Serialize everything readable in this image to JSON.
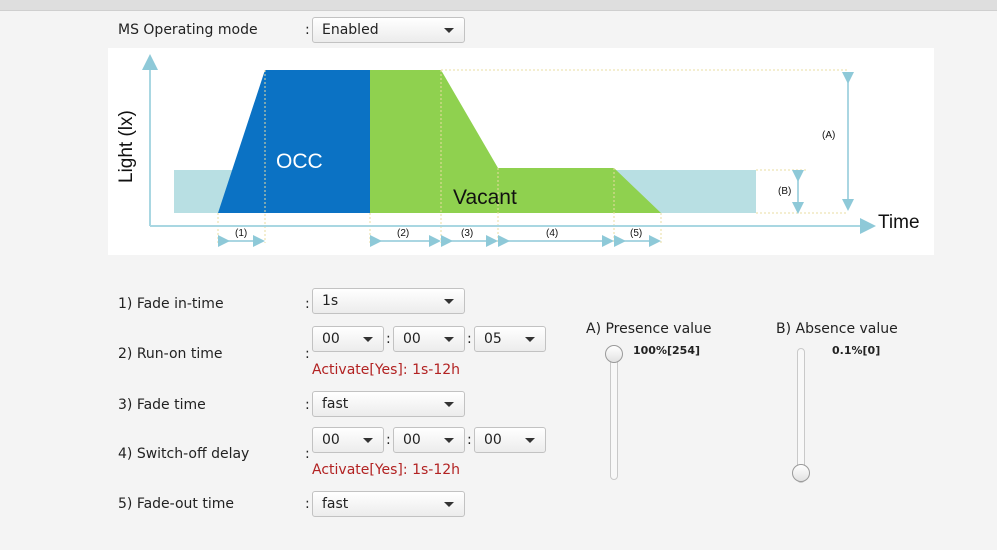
{
  "mode": {
    "label": "MS Operating mode",
    "colon": ":",
    "value": "Enabled"
  },
  "diagram": {
    "y_axis_label": "Light (lx)",
    "x_axis_label": "Time",
    "occ_label": "OCC",
    "vacant_label": "Vacant",
    "level_a_label": "(A)",
    "level_b_label": "(B)",
    "segments": [
      "(1)",
      "(2)",
      "(3)",
      "(4)",
      "(5)"
    ],
    "colors": {
      "occ": "#0b72c4",
      "vacant": "#8fd14f",
      "base": "#b8dfe3",
      "arrow": "#8ec9d8"
    }
  },
  "settings": {
    "fade_in": {
      "label": "1) Fade in-time",
      "colon": ":",
      "value": "1s"
    },
    "run_on": {
      "label": "2) Run-on time",
      "colon": ":",
      "hh": "00",
      "mm": "00",
      "ss": "05",
      "sep": ":",
      "hint": "Activate[Yes]: 1s-12h"
    },
    "fade_time": {
      "label": "3) Fade time",
      "colon": ":",
      "value": "fast"
    },
    "switch_off": {
      "label": "4) Switch-off delay",
      "colon": ":",
      "hh": "00",
      "mm": "00",
      "ss": "00",
      "sep": ":",
      "hint": "Activate[Yes]: 1s-12h"
    },
    "fade_out": {
      "label": "5) Fade-out time",
      "colon": ":",
      "value": "fast"
    }
  },
  "presence": {
    "title": "A) Presence value",
    "value_text": "100%[254]",
    "level": 1.0
  },
  "absence": {
    "title": "B) Absence value",
    "value_text": "0.1%[0]",
    "level": 0.0
  }
}
